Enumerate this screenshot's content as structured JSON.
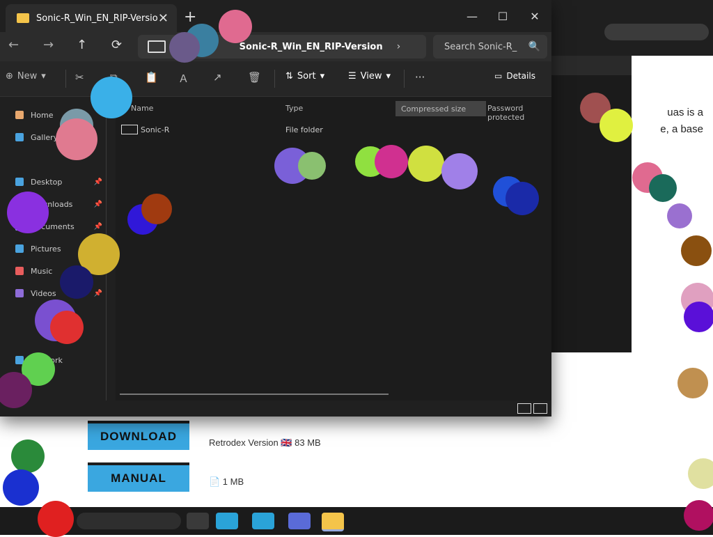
{
  "window": {
    "tab_title": "Sonic-R_Win_EN_RIP-Version",
    "tab_close": "✕",
    "new_tab": "+",
    "minimize": "—",
    "maximize": "☐",
    "close": "✕"
  },
  "navigation": {
    "back": "←",
    "forward": "→",
    "up": "↑",
    "refresh": "⟳",
    "address": "Sonic-R_Win_EN_RIP-Version",
    "chevron": "›",
    "search_placeholder": "Search Sonic-R_",
    "search_icon": "🔍"
  },
  "toolbar": {
    "new_label": "New",
    "sort_label": "Sort",
    "view_label": "View",
    "more_label": "···",
    "details_label": "Details",
    "cut_icon": "✂",
    "copy_icon": "⧉",
    "paste_icon": "📋",
    "rename_icon": "Ａ",
    "share_icon": "↗",
    "delete_icon": "🗑",
    "chevron": "▾"
  },
  "sidebar": {
    "items": [
      {
        "label": "Home",
        "icon": "home-icon",
        "color": "#e8a86e"
      },
      {
        "label": "Gallery",
        "icon": "gallery-icon",
        "color": "#4aa3df"
      },
      {
        "label": "Desktop",
        "icon": "desktop-icon",
        "color": "#4aa3df"
      },
      {
        "label": "Downloads",
        "icon": "downloads-icon",
        "color": "#3bb77e"
      },
      {
        "label": "Documents",
        "icon": "documents-icon",
        "color": "#8ab4f8"
      },
      {
        "label": "Pictures",
        "icon": "pictures-icon",
        "color": "#4aa3df"
      },
      {
        "label": "Music",
        "icon": "music-icon",
        "color": "#e85d5d"
      },
      {
        "label": "Videos",
        "icon": "videos-icon",
        "color": "#8e6cd8"
      },
      {
        "label": "Network",
        "icon": "network-icon",
        "color": "#4aa3df"
      }
    ],
    "pin": "📌"
  },
  "content": {
    "columns": {
      "name": "Name",
      "type": "Type",
      "compressed": "Compressed size",
      "password": "Password protected"
    },
    "files": [
      {
        "name": "Sonic-R",
        "type": "File folder"
      }
    ]
  },
  "background_page": {
    "snippet_line1": "uas is a",
    "snippet_line2": "e, a base",
    "download_button": "DOWNLOAD",
    "manual_button": "MANUAL",
    "download_meta": "Retrodex Version 🇬🇧 83 MB",
    "manual_meta": "📄 1 MB"
  },
  "colors": {
    "explorer_bg": "#202020",
    "accent_button": "#3aa7e0",
    "folder": "#f4c44a"
  }
}
